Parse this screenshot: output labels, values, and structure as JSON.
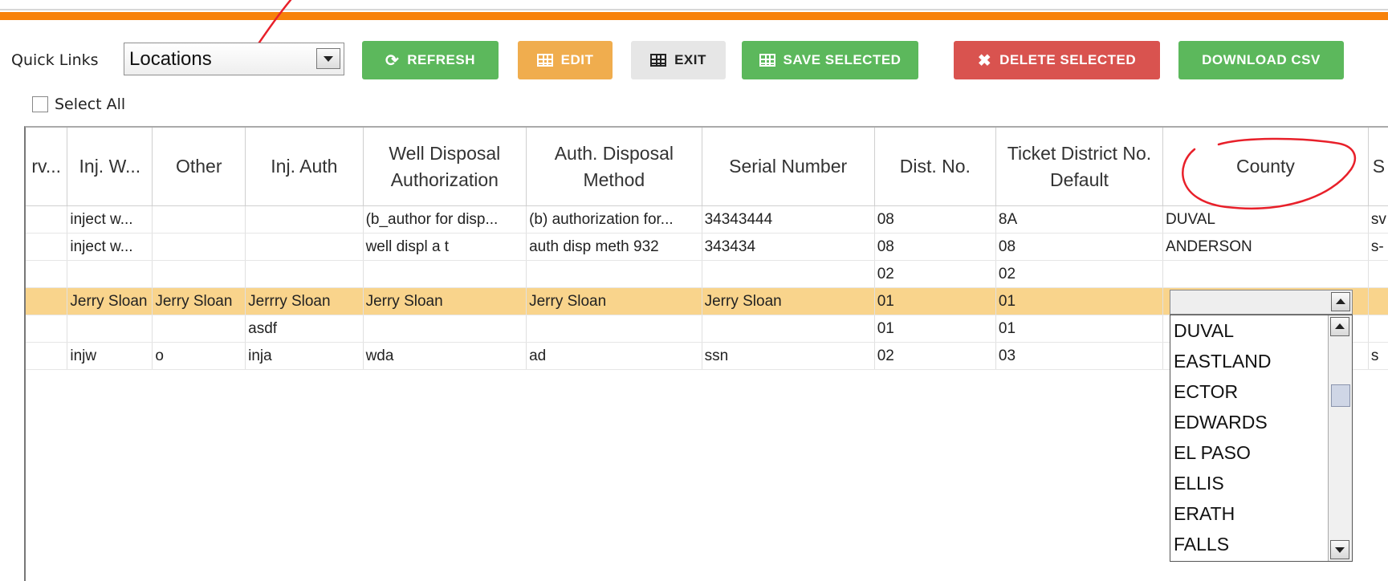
{
  "toolbar": {
    "quick_links_label": "Quick Links",
    "quick_links_value": "Locations",
    "refresh_label": "REFRESH",
    "edit_label": "EDIT",
    "exit_label": "EXIT",
    "save_selected_label": "SAVE SELECTED",
    "delete_selected_label": "DELETE SELECTED",
    "download_csv_label": "DOWNLOAD CSV",
    "select_all_label": "Select All"
  },
  "colors": {
    "orange_bar": "#f7820a",
    "refresh": "#5cb85c",
    "edit": "#f0ad4e",
    "delete": "#d9534f",
    "selected_row": "#f9d48c",
    "annotation": "#e8202a"
  },
  "table": {
    "headers": [
      "rv...",
      "Inj. W...",
      "Other",
      "Inj. Auth",
      "Well Disposal Authorization",
      "Auth. Disposal Method",
      "Serial Number",
      "Dist. No.",
      "Ticket District No. Default",
      "County",
      "S"
    ],
    "rows": [
      [
        "",
        "inject w...",
        "",
        "",
        "(b_author for disp...",
        "(b) authorization for...",
        "34343444",
        "08",
        "8A",
        "DUVAL",
        "sv"
      ],
      [
        "",
        "inject w...",
        "",
        "",
        "well displ a t",
        "auth disp meth 932",
        "343434",
        "08",
        "08",
        "ANDERSON",
        "s-"
      ],
      [
        "",
        "",
        "",
        "",
        "",
        "",
        "",
        "02",
        "02",
        "",
        ""
      ],
      [
        "",
        "Jerry Sloan",
        "Jerry Sloan",
        "Jerrry Sloan",
        "Jerry Sloan",
        "Jerry Sloan",
        "Jerry Sloan",
        "01",
        "01",
        "",
        ""
      ],
      [
        "",
        "",
        "",
        "asdf",
        "",
        "",
        "",
        "01",
        "01",
        "",
        ""
      ],
      [
        "",
        "injw",
        "o",
        "inja",
        "wda",
        "ad",
        "ssn",
        "02",
        "03",
        "",
        "s"
      ]
    ]
  },
  "county_dropdown": {
    "options": [
      "DUVAL",
      "EASTLAND",
      "ECTOR",
      "EDWARDS",
      "EL PASO",
      "ELLIS",
      "ERATH",
      "FALLS"
    ]
  }
}
